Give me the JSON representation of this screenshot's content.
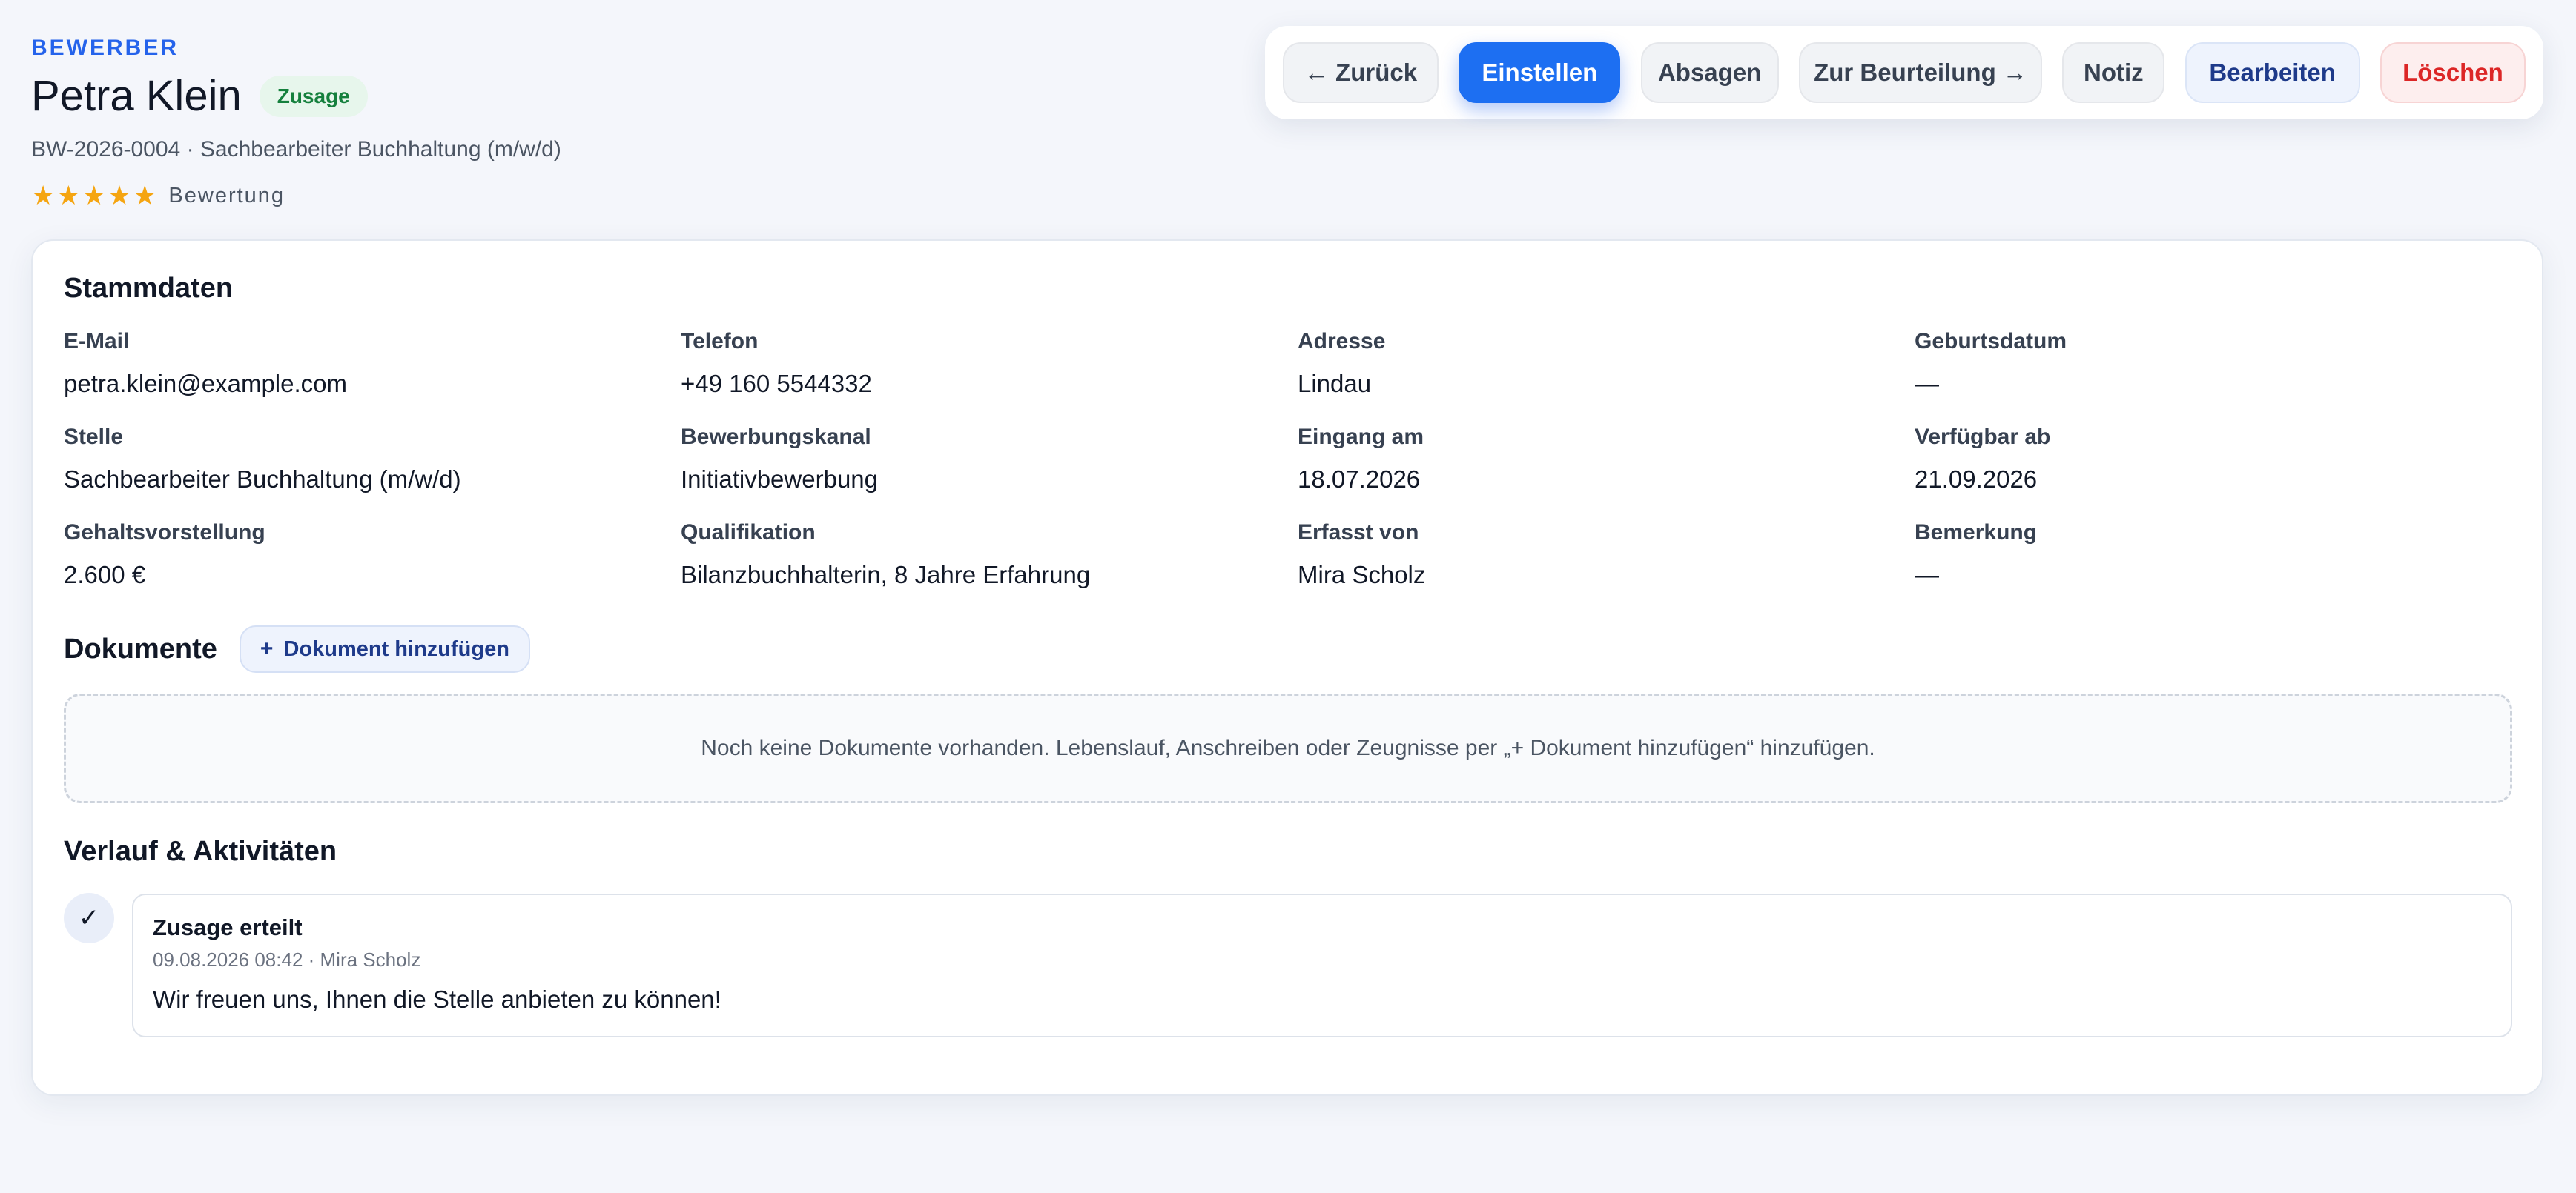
{
  "header": {
    "eyebrow": "BEWERBER",
    "name": "Petra Klein",
    "status_badge": "Zusage",
    "subtitle": "BW-2026-0004 · Sachbearbeiter Buchhaltung (m/w/d)",
    "rating_label": "Bewertung",
    "rating_stars": 5,
    "star_glyph": "★"
  },
  "toolbar": {
    "back": "← Zurück",
    "hire": "Einstellen",
    "reject": "Absagen",
    "to_review": "Zur Beurteilung →",
    "note": "Notiz",
    "edit": "Bearbeiten",
    "delete": "Löschen"
  },
  "master_data": {
    "title": "Stammdaten",
    "fields": [
      {
        "label": "E-Mail",
        "value": "petra.klein@example.com"
      },
      {
        "label": "Telefon",
        "value": "+49 160 5544332"
      },
      {
        "label": "Adresse",
        "value": "Lindau"
      },
      {
        "label": "Geburtsdatum",
        "value": "—"
      },
      {
        "label": "Stelle",
        "value": "Sachbearbeiter Buchhaltung (m/w/d)"
      },
      {
        "label": "Bewerbungskanal",
        "value": "Initiativbewerbung"
      },
      {
        "label": "Eingang am",
        "value": "18.07.2026"
      },
      {
        "label": "Verfügbar ab",
        "value": "21.09.2026"
      },
      {
        "label": "Gehaltsvorstellung",
        "value": "2.600 €"
      },
      {
        "label": "Qualifikation",
        "value": "Bilanzbuchhalterin, 8 Jahre Erfahrung"
      },
      {
        "label": "Erfasst von",
        "value": "Mira Scholz"
      },
      {
        "label": "Bemerkung",
        "value": "—"
      }
    ]
  },
  "documents": {
    "title": "Dokumente",
    "add_icon": "+",
    "add_label": "Dokument hinzufügen",
    "empty_text": "Noch keine Dokumente vorhanden. Lebenslauf, Anschreiben oder Zeugnisse per „+  Dokument hinzufügen“ hinzufügen."
  },
  "history": {
    "title": "Verlauf & Aktivitäten",
    "entries": [
      {
        "icon": "✓",
        "title": "Zusage erteilt",
        "meta": "09.08.2026 08:42 · Mira Scholz",
        "text": "Wir freuen uns, Ihnen die Stelle anbieten zu können!"
      }
    ]
  },
  "colors": {
    "accent": "#2563eb",
    "primary_button": "#1d6ff2",
    "success": "#15803d",
    "danger": "#dc2626",
    "star": "#f5a511"
  }
}
